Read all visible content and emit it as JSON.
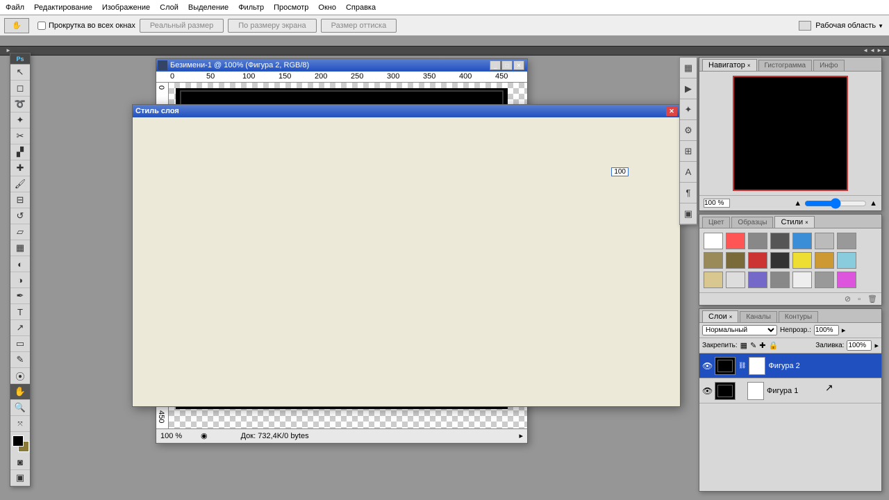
{
  "menu": {
    "file": "Файл",
    "edit": "Редактирование",
    "image": "Изображение",
    "layer": "Слой",
    "select": "Выделение",
    "filter": "Фильтр",
    "view": "Просмотр",
    "window": "Окно",
    "help": "Справка"
  },
  "opt": {
    "scroll": "Прокрутка во всех окнах",
    "actual": "Реальный размер",
    "fit": "По размеру экрана",
    "print": "Размер оттиска",
    "workspace": "Рабочая область"
  },
  "doc": {
    "title": "Безимени-1 @ 100% (Фигура 2, RGB/8)",
    "zoom": "100 %",
    "status": "Док: 732,4K/0 bytes",
    "badge": "100"
  },
  "dlg": {
    "title": "Стиль слоя"
  },
  "nav": {
    "t1": "Навигатор",
    "t2": "Гистограмма",
    "t3": "Инфо",
    "zoom": "100 %"
  },
  "col": {
    "t1": "Цвет",
    "t2": "Образцы",
    "t3": "Стили"
  },
  "lay": {
    "t1": "Слои",
    "t2": "Каналы",
    "t3": "Контуры",
    "mode": "Нормальный",
    "opacity_l": "Непрозр.:",
    "opacity_v": "100%",
    "lock_l": "Закрепить:",
    "fill_l": "Заливка:",
    "fill_v": "100%",
    "l1": "Фигура 2",
    "l2": "Фигура 1"
  },
  "swatches": [
    "#fff",
    "#f55",
    "#888",
    "#555",
    "#3a8ed8",
    "#bbb",
    "#999",
    "#9a8a5a",
    "#7a6a3a",
    "#c33",
    "#333",
    "#ed3",
    "#c93",
    "#8cd",
    "#d8c890",
    "#ddd",
    "#7468c8",
    "#888",
    "#eee",
    "#999",
    "#d5d"
  ],
  "ruler": [
    "0",
    "50",
    "100",
    "150",
    "200",
    "250",
    "300",
    "350",
    "400",
    "450"
  ]
}
